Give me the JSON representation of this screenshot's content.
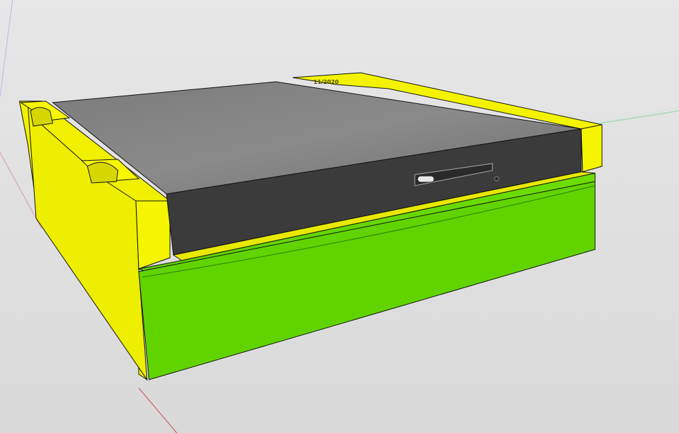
{
  "scene": {
    "engraved_text": "11/2020",
    "colors": {
      "background": "#dddddd",
      "frame": "#f5f500",
      "frame_shadow": "#d8d800",
      "drive_top": "#6a6a6a",
      "drive_front": "#3a3a3a",
      "tray": "#5fd300",
      "tray_top": "#6ee000",
      "outline": "#111111",
      "axis_red": "#d04a4a",
      "axis_green": "#4fbf6a",
      "axis_blue": "#8a8ad0"
    },
    "icons": [
      "eject-button-icon",
      "status-led-icon"
    ]
  }
}
